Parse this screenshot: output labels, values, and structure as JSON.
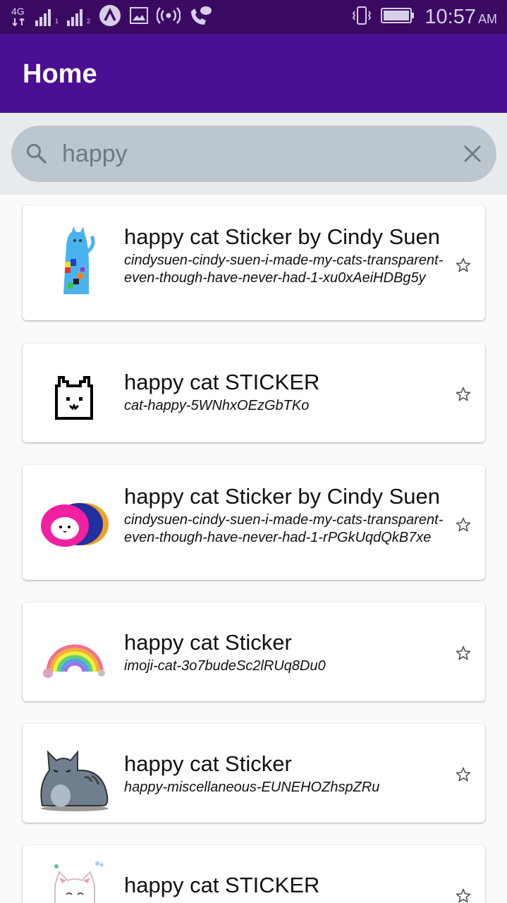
{
  "status_bar": {
    "network": "4G",
    "sim1": "1",
    "sim2": "2",
    "time": "10:57",
    "ampm": "AM",
    "icons": [
      "network-4g-icon",
      "signal-icon",
      "signal-icon",
      "app-icon",
      "image-icon",
      "hotspot-icon",
      "wifi-call-icon",
      "vibrate-icon",
      "battery-icon"
    ]
  },
  "appbar": {
    "title": "Home"
  },
  "search": {
    "value": "happy",
    "placeholder": ""
  },
  "results": [
    {
      "title": "happy cat Sticker by Cindy Suen",
      "slug": "cindysuen-cindy-suen-i-made-my-cats-transparent-even-though-have-never-had-1-xu0xAeiHDBg5y",
      "thumb": "tall-cat-icon"
    },
    {
      "title": "happy cat STICKER",
      "slug": "cat-happy-5WNhxOEzGbTKo",
      "thumb": "pixel-cat-icon"
    },
    {
      "title": "happy cat Sticker by Cindy Suen",
      "slug": "cindysuen-cindy-suen-i-made-my-cats-transparent-even-though-have-never-had-1-rPGkUqdQkB7xe",
      "thumb": "roll-cat-icon"
    },
    {
      "title": "happy cat Sticker",
      "slug": "imoji-cat-3o7budeSc2lRUq8Du0",
      "thumb": "rainbow-cat-icon"
    },
    {
      "title": "happy cat Sticker",
      "slug": "happy-miscellaneous-EUNEHOZhspZRu",
      "thumb": "grey-cat-icon"
    },
    {
      "title": "happy cat STICKER",
      "slug": "",
      "thumb": "white-cat-icon"
    }
  ],
  "colors": {
    "status_bar": "#3a0a63",
    "app_bar": "#4b0f93",
    "search_bg": "#bcc6ce",
    "page_bg": "#fafafa"
  }
}
